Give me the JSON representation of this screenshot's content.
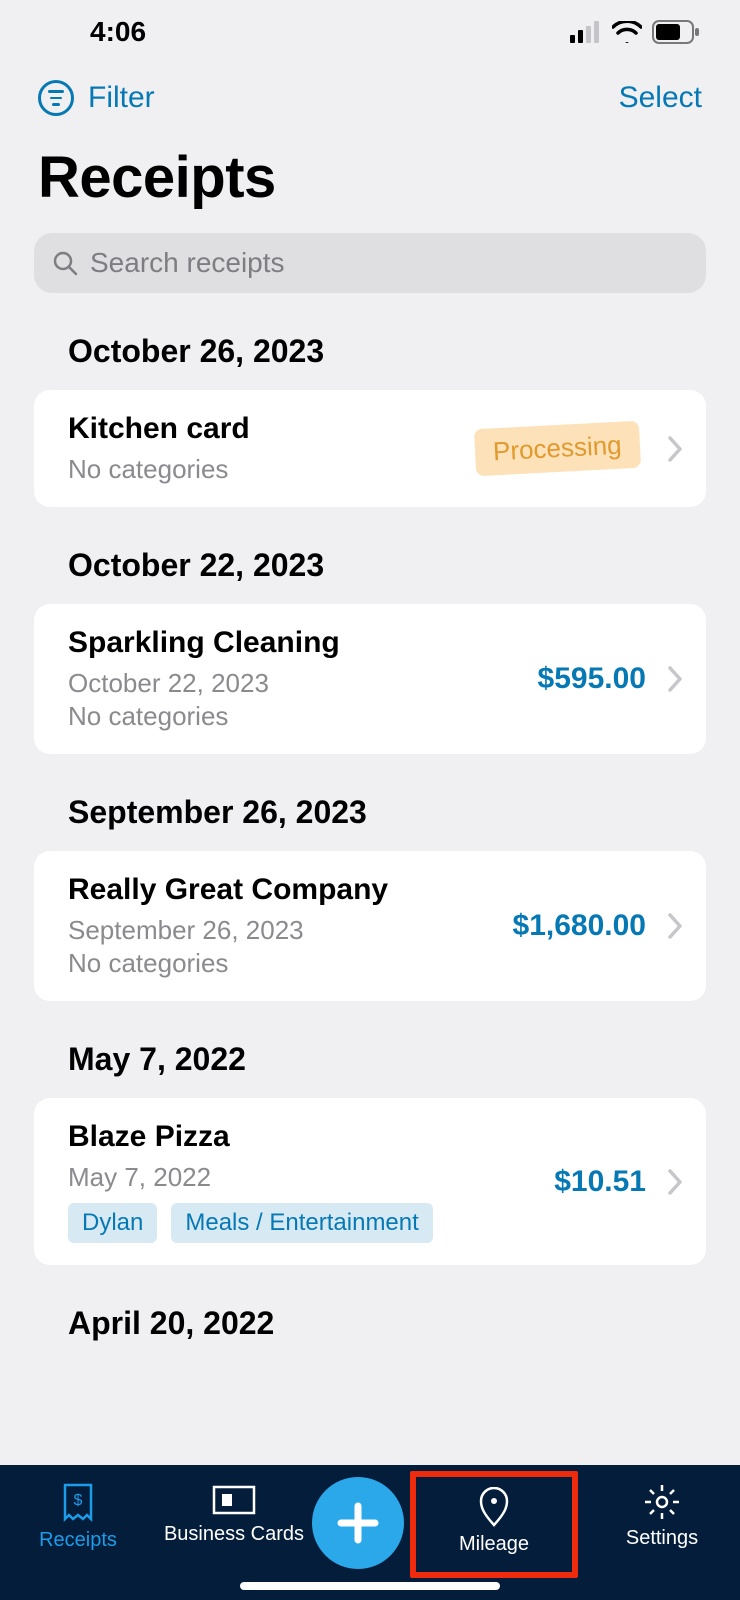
{
  "status": {
    "time": "4:06"
  },
  "topbar": {
    "filter_label": "Filter",
    "select_label": "Select"
  },
  "title": "Receipts",
  "search": {
    "placeholder": "Search receipts"
  },
  "sections": [
    {
      "header": "October 26, 2023",
      "items": [
        {
          "title": "Kitchen card",
          "subtitle": "",
          "nocat": "No categories",
          "status_badge": "Processing",
          "amount": "",
          "tags": []
        }
      ]
    },
    {
      "header": "October 22, 2023",
      "items": [
        {
          "title": "Sparkling Cleaning",
          "subtitle": "October 22, 2023",
          "nocat": "No categories",
          "status_badge": "",
          "amount": "$595.00",
          "tags": []
        }
      ]
    },
    {
      "header": "September 26, 2023",
      "items": [
        {
          "title": "Really Great Company",
          "subtitle": "September 26, 2023",
          "nocat": "No categories",
          "status_badge": "",
          "amount": "$1,680.00",
          "tags": []
        }
      ]
    },
    {
      "header": "May 7, 2022",
      "items": [
        {
          "title": "Blaze Pizza",
          "subtitle": "May 7, 2022",
          "nocat": "",
          "status_badge": "",
          "amount": "$10.51",
          "tags": [
            "Dylan",
            "Meals / Entertainment"
          ]
        }
      ]
    },
    {
      "header": "April 20, 2022",
      "items": []
    }
  ],
  "tabs": {
    "receipts": "Receipts",
    "business_cards": "Business Cards",
    "mileage": "Mileage",
    "settings": "Settings"
  }
}
